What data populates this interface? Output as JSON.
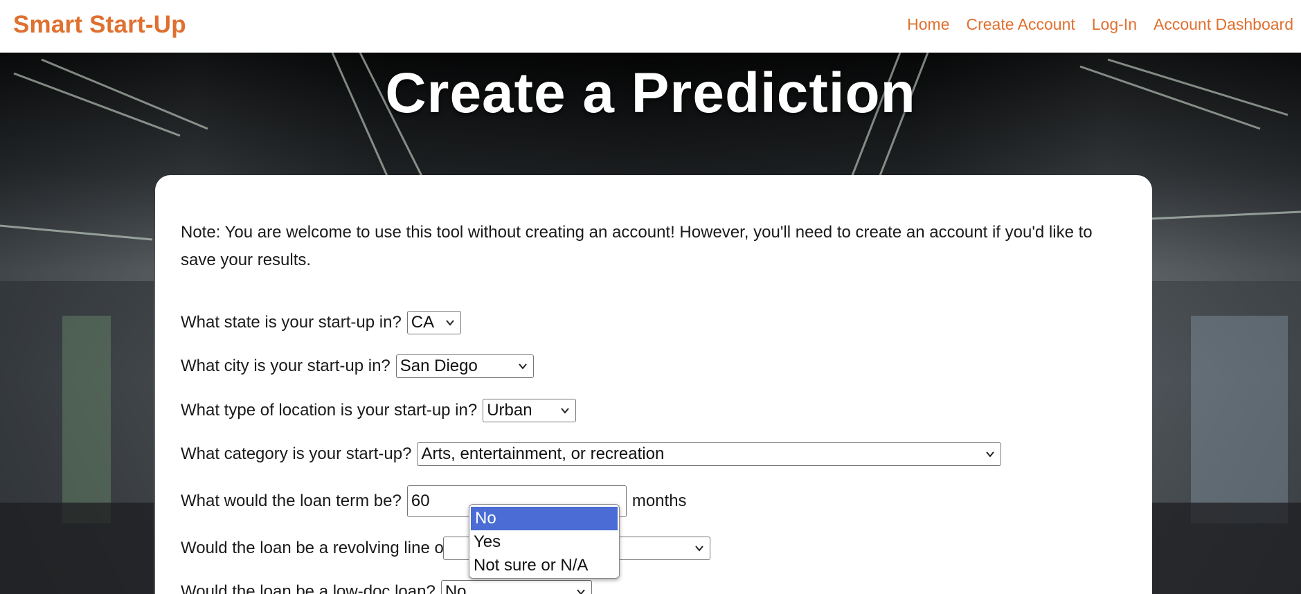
{
  "nav": {
    "brand": "Smart Start-Up",
    "links": [
      "Home",
      "Create Account",
      "Log-In",
      "Account Dashboard"
    ]
  },
  "hero": {
    "title": "Create a Prediction"
  },
  "form": {
    "note": "Note: You are welcome to use this tool without creating an account! However, you'll need to create an account if you'd like to save your results.",
    "state": {
      "label": "What state is your start-up in?",
      "value": "CA"
    },
    "city": {
      "label": "What city is your start-up in?",
      "value": "San Diego"
    },
    "location_type": {
      "label": "What type of location is your start-up in?",
      "value": "Urban"
    },
    "category": {
      "label": "What category is your start-up?",
      "value": "Arts, entertainment, or recreation"
    },
    "loan_term": {
      "label": "What would the loan term be?",
      "value": "60",
      "suffix": "months"
    },
    "revolving": {
      "label": "Would the loan be a revolving line o",
      "value": ""
    },
    "low_doc": {
      "label": "Would the loan be a low-doc loan?",
      "value": "No"
    }
  },
  "dropdown": {
    "options": [
      "No",
      "Yes",
      "Not sure or N/A"
    ],
    "selected": "No"
  },
  "colors": {
    "accent": "#e0702f",
    "selected_option": "#4a6cd4"
  }
}
